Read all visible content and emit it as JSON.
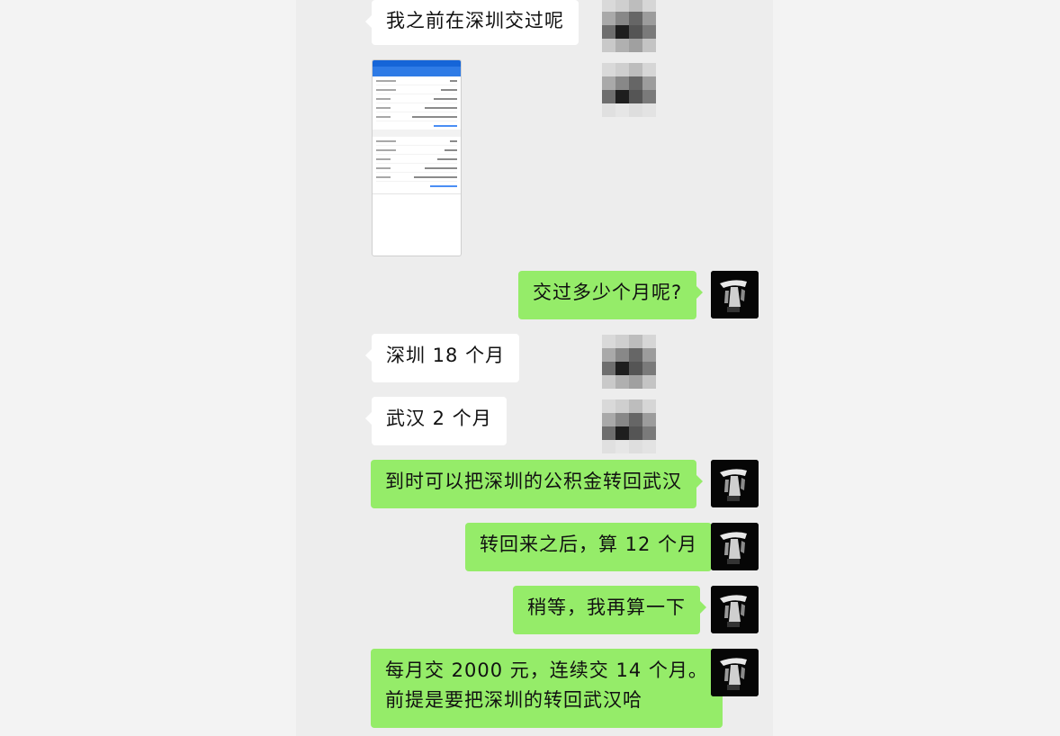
{
  "conversation": {
    "messages": [
      {
        "side": "in",
        "lines": [
          "我之前在深圳交过呢"
        ]
      },
      {
        "side": "in",
        "type": "image",
        "image_label": "公积金账户截图"
      },
      {
        "side": "out",
        "lines": [
          "交过多少个月呢?"
        ]
      },
      {
        "side": "in",
        "lines": [
          "深圳 18 个月"
        ]
      },
      {
        "side": "in",
        "lines": [
          "武汉 2 个月"
        ]
      },
      {
        "side": "out",
        "lines": [
          "到时可以把深圳的公积金转回武汉"
        ]
      },
      {
        "side": "out",
        "lines": [
          "转回来之后，算 12 个月"
        ]
      },
      {
        "side": "out",
        "lines": [
          "稍等，我再算一下"
        ]
      },
      {
        "side": "out",
        "lines": [
          "每月交 2000 元，连续交 14 个月。",
          "前提是要把深圳的转回武汉哈"
        ]
      }
    ]
  },
  "avatars": {
    "contact": "pixelated-avatar",
    "self": "dark-photo-avatar"
  },
  "colors": {
    "chat_background": "#ededed",
    "incoming_bubble": "#ffffff",
    "outgoing_bubble": "#95ec69",
    "page_background": "#f3f3f3"
  }
}
